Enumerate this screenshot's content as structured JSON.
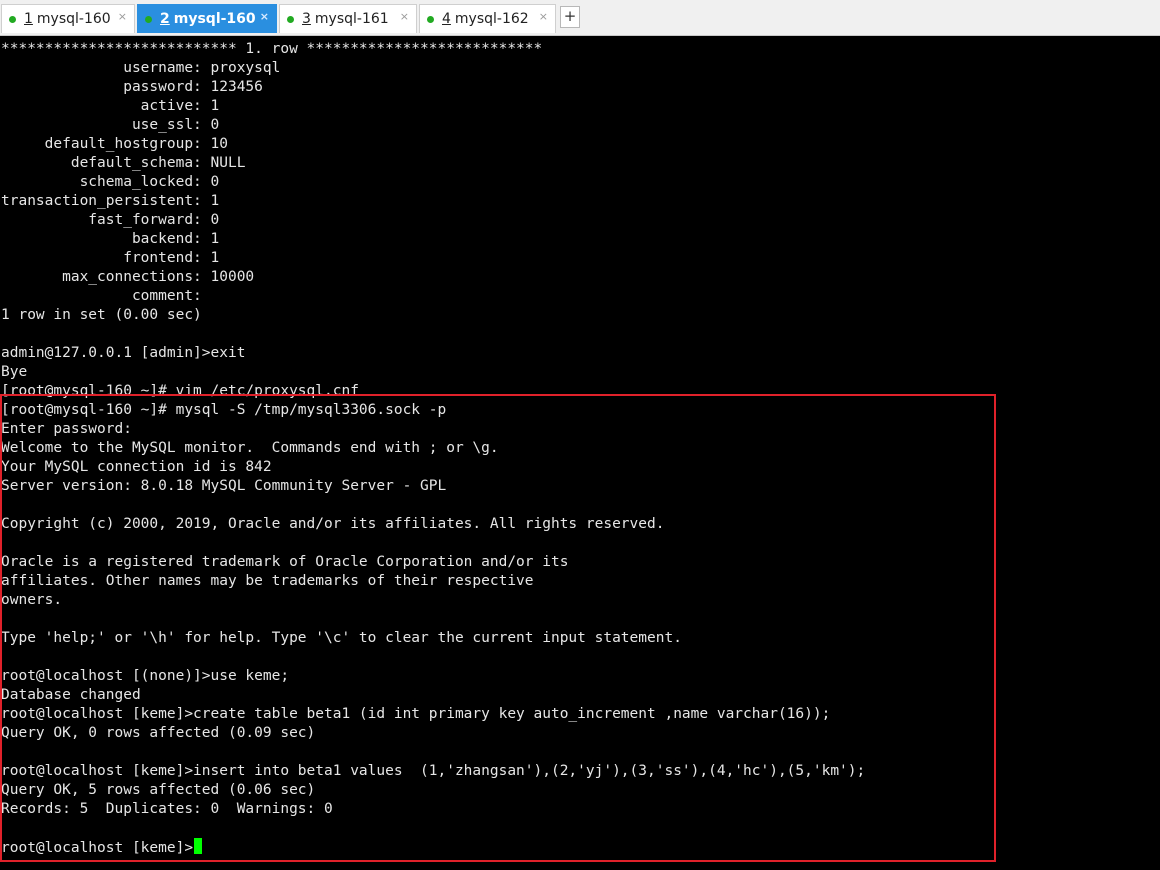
{
  "tabs": [
    {
      "num": "1",
      "label": "mysql-160",
      "active": false
    },
    {
      "num": "2",
      "label": "mysql-160",
      "active": true
    },
    {
      "num": "3",
      "label": "mysql-161",
      "active": false
    },
    {
      "num": "4",
      "label": "mysql-162",
      "active": false
    }
  ],
  "tab_close_glyph": "×",
  "new_tab_glyph": "+",
  "terminal": {
    "lines": [
      "*************************** 1. row ***************************",
      "              username: proxysql",
      "              password: 123456",
      "                active: 1",
      "               use_ssl: 0",
      "     default_hostgroup: 10",
      "        default_schema: NULL",
      "         schema_locked: 0",
      "transaction_persistent: 1",
      "          fast_forward: 0",
      "               backend: 1",
      "              frontend: 1",
      "       max_connections: 10000",
      "               comment: ",
      "1 row in set (0.00 sec)",
      "",
      "admin@127.0.0.1 [admin]>exit",
      "Bye",
      "[root@mysql-160 ~]# vim /etc/proxysql.cnf",
      "[root@mysql-160 ~]# mysql -S /tmp/mysql3306.sock -p",
      "Enter password: ",
      "Welcome to the MySQL monitor.  Commands end with ; or \\g.",
      "Your MySQL connection id is 842",
      "Server version: 8.0.18 MySQL Community Server - GPL",
      "",
      "Copyright (c) 2000, 2019, Oracle and/or its affiliates. All rights reserved.",
      "",
      "Oracle is a registered trademark of Oracle Corporation and/or its",
      "affiliates. Other names may be trademarks of their respective",
      "owners.",
      "",
      "Type 'help;' or '\\h' for help. Type '\\c' to clear the current input statement.",
      "",
      "root@localhost [(none)]>use keme;",
      "Database changed",
      "root@localhost [keme]>create table beta1 (id int primary key auto_increment ,name varchar(16));",
      "Query OK, 0 rows affected (0.09 sec)",
      "",
      "root@localhost [keme]>insert into beta1 values  (1,'zhangsan'),(2,'yj'),(3,'ss'),(4,'hc'),(5,'km');",
      "Query OK, 5 rows affected (0.06 sec)",
      "Records: 5  Duplicates: 0  Warnings: 0",
      "",
      "root@localhost [keme]>"
    ]
  },
  "colors": {
    "terminal_bg": "#000000",
    "terminal_fg": "#e6e6e6",
    "cursor": "#00ff00",
    "highlight_border": "#e0212a",
    "active_tab": "#2a8fe0",
    "status_dot": "#22aa22"
  }
}
